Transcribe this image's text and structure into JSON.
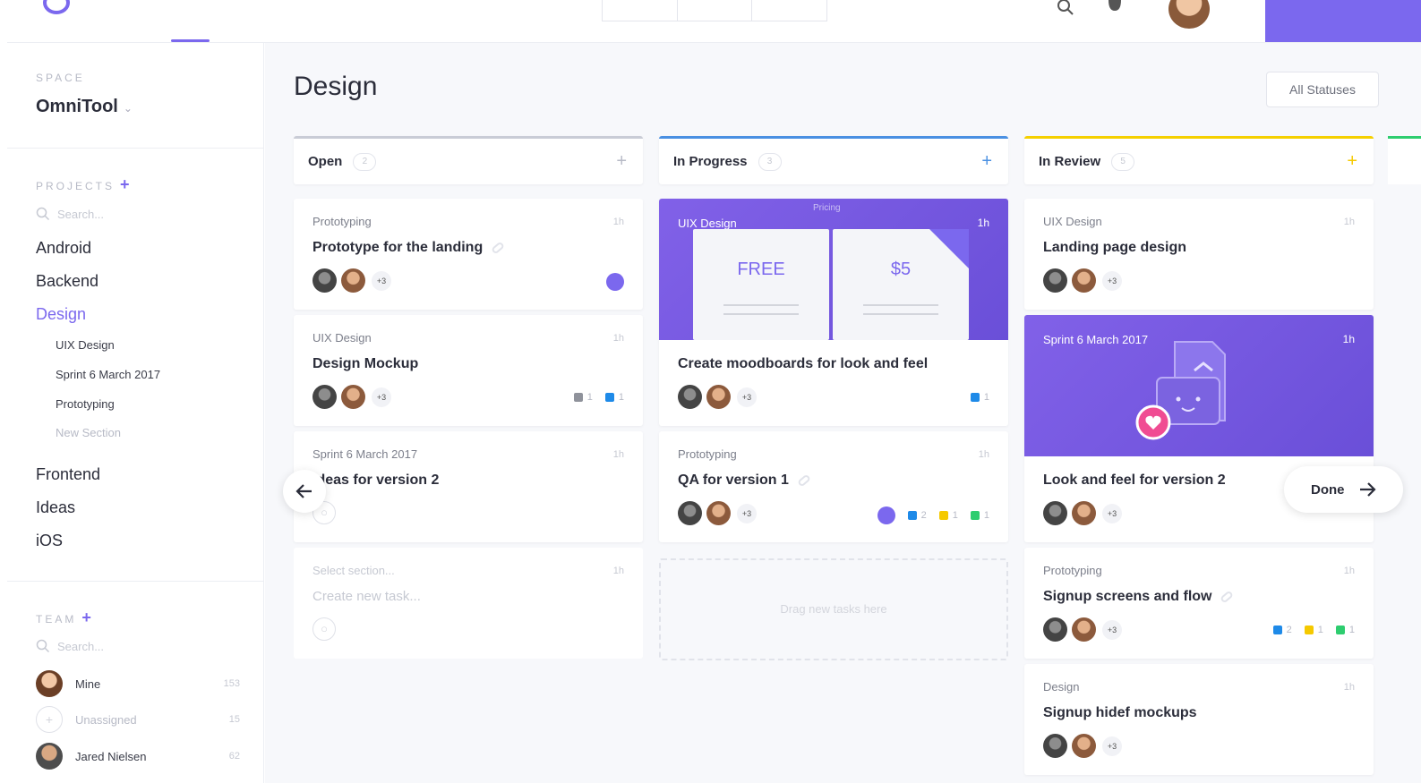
{
  "sidebar": {
    "space_caption": "SPACE",
    "space_name": "OmniTool",
    "projects_caption": "PROJECTS",
    "projects_search": "Search...",
    "projects": [
      {
        "label": "Android"
      },
      {
        "label": "Backend"
      },
      {
        "label": "Design"
      },
      {
        "label": "Frontend"
      },
      {
        "label": "Ideas"
      },
      {
        "label": "iOS"
      }
    ],
    "sub_sections": [
      {
        "label": "UIX Design"
      },
      {
        "label": "Sprint 6 March 2017"
      },
      {
        "label": "Prototyping"
      },
      {
        "label": "New Section"
      }
    ],
    "team_caption": "TEAM",
    "team_search": "Search...",
    "team": [
      {
        "name": "Mine",
        "count": "153"
      },
      {
        "name": "Unassigned",
        "count": "15"
      },
      {
        "name": "Jared Nielsen",
        "count": "62"
      }
    ]
  },
  "main": {
    "title": "Design",
    "status_filter": "All Statuses",
    "done_label": "Done"
  },
  "columns": [
    {
      "name": "Open",
      "count": "2",
      "cards": [
        {
          "section": "Prototyping",
          "time": "1h",
          "title": "Prototype for the landing",
          "more": "+3"
        },
        {
          "section": "UIX Design",
          "time": "1h",
          "title": "Design Mockup",
          "more": "+3",
          "badges": [
            "1",
            "1"
          ]
        },
        {
          "section": "Sprint 6 March 2017",
          "time": "1h",
          "title": "Ideas for version 2"
        },
        {
          "section": "Select section...",
          "time": "1h",
          "title": "Create new task..."
        }
      ]
    },
    {
      "name": "In Progress",
      "count": "3",
      "cards": [
        {
          "section": "UIX Design",
          "time": "1h",
          "title": "Create moodboards for look and feel",
          "more": "+3",
          "badges": [
            "1"
          ],
          "banner": {
            "top": "Pricing",
            "free": "FREE",
            "paid": "$5"
          }
        },
        {
          "section": "Prototyping",
          "time": "1h",
          "title": "QA for version 1",
          "more": "+3",
          "badges": [
            "2",
            "1",
            "1"
          ]
        }
      ],
      "drop_text": "Drag new tasks here"
    },
    {
      "name": "In Review",
      "count": "5",
      "cards": [
        {
          "section": "UIX Design",
          "time": "1h",
          "title": "Landing page design",
          "more": "+3"
        },
        {
          "section": "Sprint 6 March 2017",
          "time": "1h",
          "title": "Look and feel for version 2",
          "more": "+3"
        },
        {
          "section": "Prototyping",
          "time": "1h",
          "title": "Signup screens and flow",
          "more": "+3",
          "badges": [
            "2",
            "1",
            "1"
          ]
        },
        {
          "section": "Design",
          "time": "1h",
          "title": "Signup hidef mockups",
          "more": "+3"
        }
      ]
    }
  ],
  "colors": {
    "accent": "#7b68ee",
    "open": "#c9ccd6",
    "in_progress": "#4a90e2",
    "in_review": "#f5d000",
    "done": "#2ecd6f"
  }
}
